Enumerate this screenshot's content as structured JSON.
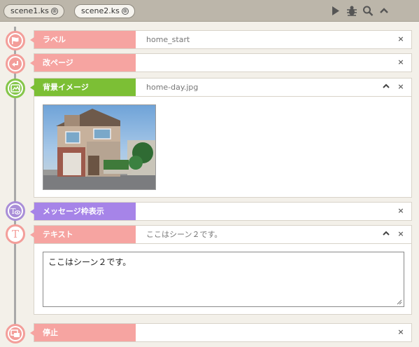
{
  "tabs": [
    {
      "label": "scene1.ks",
      "close": "⊗"
    },
    {
      "label": "scene2.ks",
      "close": "⊗"
    }
  ],
  "toolbar": {
    "icons": [
      "play-icon",
      "bug-icon",
      "search-icon",
      "chevron-up-icon"
    ]
  },
  "commands": [
    {
      "label": "ラベル",
      "value": "home_start",
      "icon": "flag-icon",
      "close": "×"
    },
    {
      "label": "改ページ",
      "value": "",
      "icon": "return-arrow-icon",
      "close": "×"
    },
    {
      "label": "背景イメージ",
      "value": "home-day.jpg",
      "icon": "image-icon",
      "close": "×",
      "expanded": true
    },
    {
      "label": "メッセージ枠表示",
      "value": "",
      "icon": "text-eye-icon",
      "close": "×"
    },
    {
      "label": "テキスト",
      "value": "ここはシーン２です。",
      "icon": "text-t-icon",
      "glyph": "T",
      "close": "×",
      "expanded": true,
      "body": "ここはシーン２です。"
    },
    {
      "label": "停止",
      "value": "",
      "icon": "window-stop-icon",
      "close": "×"
    }
  ],
  "colors": {
    "pink": "#f6a4a1",
    "green": "#7cbf35",
    "purple": "#a684e8",
    "tabbar": "#bcb6aa"
  }
}
